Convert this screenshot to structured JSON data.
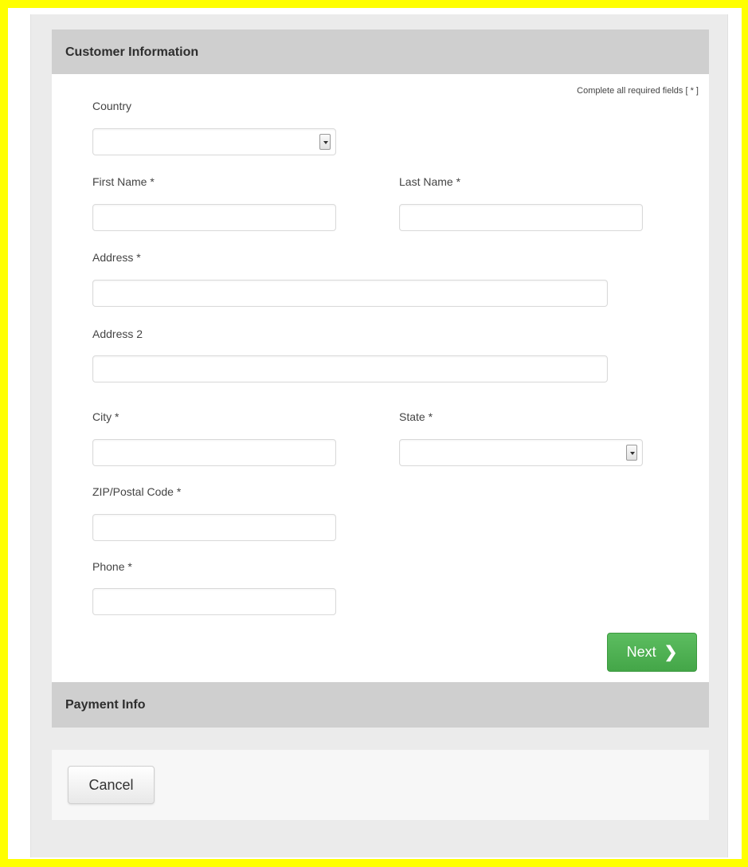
{
  "sections": {
    "customer_info": "Customer Information",
    "payment_info": "Payment Info"
  },
  "required_note": "Complete all required fields [ * ]",
  "fields": {
    "country": {
      "label": "Country",
      "value": ""
    },
    "first_name": {
      "label": "First Name *",
      "value": ""
    },
    "last_name": {
      "label": "Last Name *",
      "value": ""
    },
    "address": {
      "label": "Address *",
      "value": ""
    },
    "address2": {
      "label": "Address 2",
      "value": ""
    },
    "city": {
      "label": "City *",
      "value": ""
    },
    "state": {
      "label": "State *",
      "value": ""
    },
    "zip": {
      "label": "ZIP/Postal Code *",
      "value": ""
    },
    "phone": {
      "label": "Phone *",
      "value": ""
    }
  },
  "buttons": {
    "next": "Next",
    "cancel": "Cancel"
  },
  "colors": {
    "highlight_border": "#ffff00",
    "next_button": "#4cae4f",
    "section_header": "#cfcfcf"
  },
  "icons": {
    "next": "chevron-right-icon",
    "select": "dropdown-arrow-icon"
  }
}
